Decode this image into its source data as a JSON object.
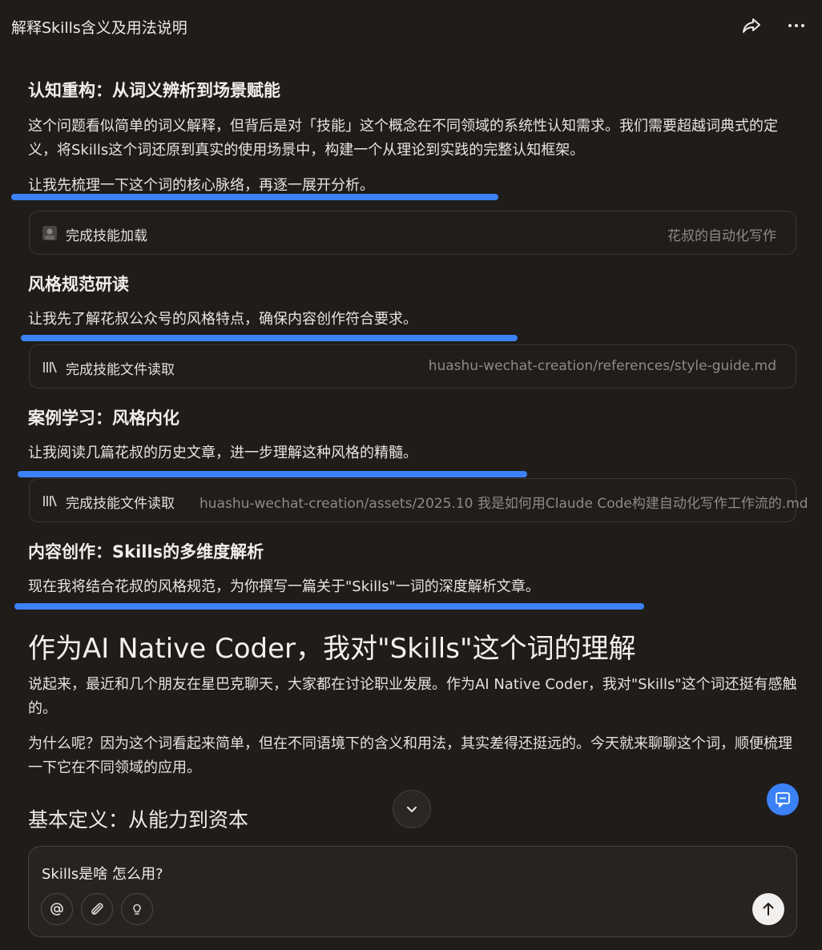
{
  "header": {
    "title": "解释Skills含义及用法说明"
  },
  "sections": [
    {
      "heading": "认知重构：从词义辨析到场景赋能",
      "paragraph": "这个问题看似简单的词义解释，但背后是对「技能」这个概念在不同领域的系统性认知需求。我们需要超越词典式的定义，将Skills这个词还原到真实的使用场景中，构建一个从理论到实践的完整认知框架。",
      "note": "让我先梳理一下这个词的核心脉络，再逐一展开分析。",
      "tool_card": {
        "icon": "avatar-icon",
        "label": "完成技能加载",
        "meta": "花叔的自动化写作"
      }
    },
    {
      "heading": "风格规范研读",
      "note": "让我先了解花叔公众号的风格特点，确保内容创作符合要求。",
      "tool_card": {
        "icon": "library-icon",
        "label": "完成技能文件读取",
        "meta": "huashu-wechat-creation/references/style-guide.md"
      }
    },
    {
      "heading": "案例学习：风格内化",
      "note": "让我阅读几篇花叔的历史文章，进一步理解这种风格的精髓。",
      "tool_card": {
        "icon": "library-icon",
        "label": "完成技能文件读取",
        "meta": "huashu-wechat-creation/assets/2025.10 我是如何用Claude Code构建自动化写作工作流的.md"
      }
    },
    {
      "heading": "内容创作：Skills的多维度解析",
      "note": "现在我将结合花叔的风格规范，为你撰写一篇关于\"Skills\"一词的深度解析文章。"
    }
  ],
  "article": {
    "title": "作为AI Native Coder，我对\"Skills\"这个词的理解",
    "paragraphs": [
      "说起来，最近和几个朋友在星巴克聊天，大家都在讨论职业发展。作为AI Native Coder，我对\"Skills\"这个词还挺有感触的。",
      "为什么呢？因为这个词看起来简单，但在不同语境下的含义和用法，其实差得还挺远的。今天就来聊聊这个词，顺便梳理一下它在不同领域的应用。"
    ],
    "subheading": "基本定义：从能力到资本"
  },
  "composer": {
    "value": "Skills是啥  怎么用?"
  },
  "colors": {
    "background": "#1f1c1a",
    "highlight": "#3b82f6",
    "fab": "#3b82f6"
  }
}
